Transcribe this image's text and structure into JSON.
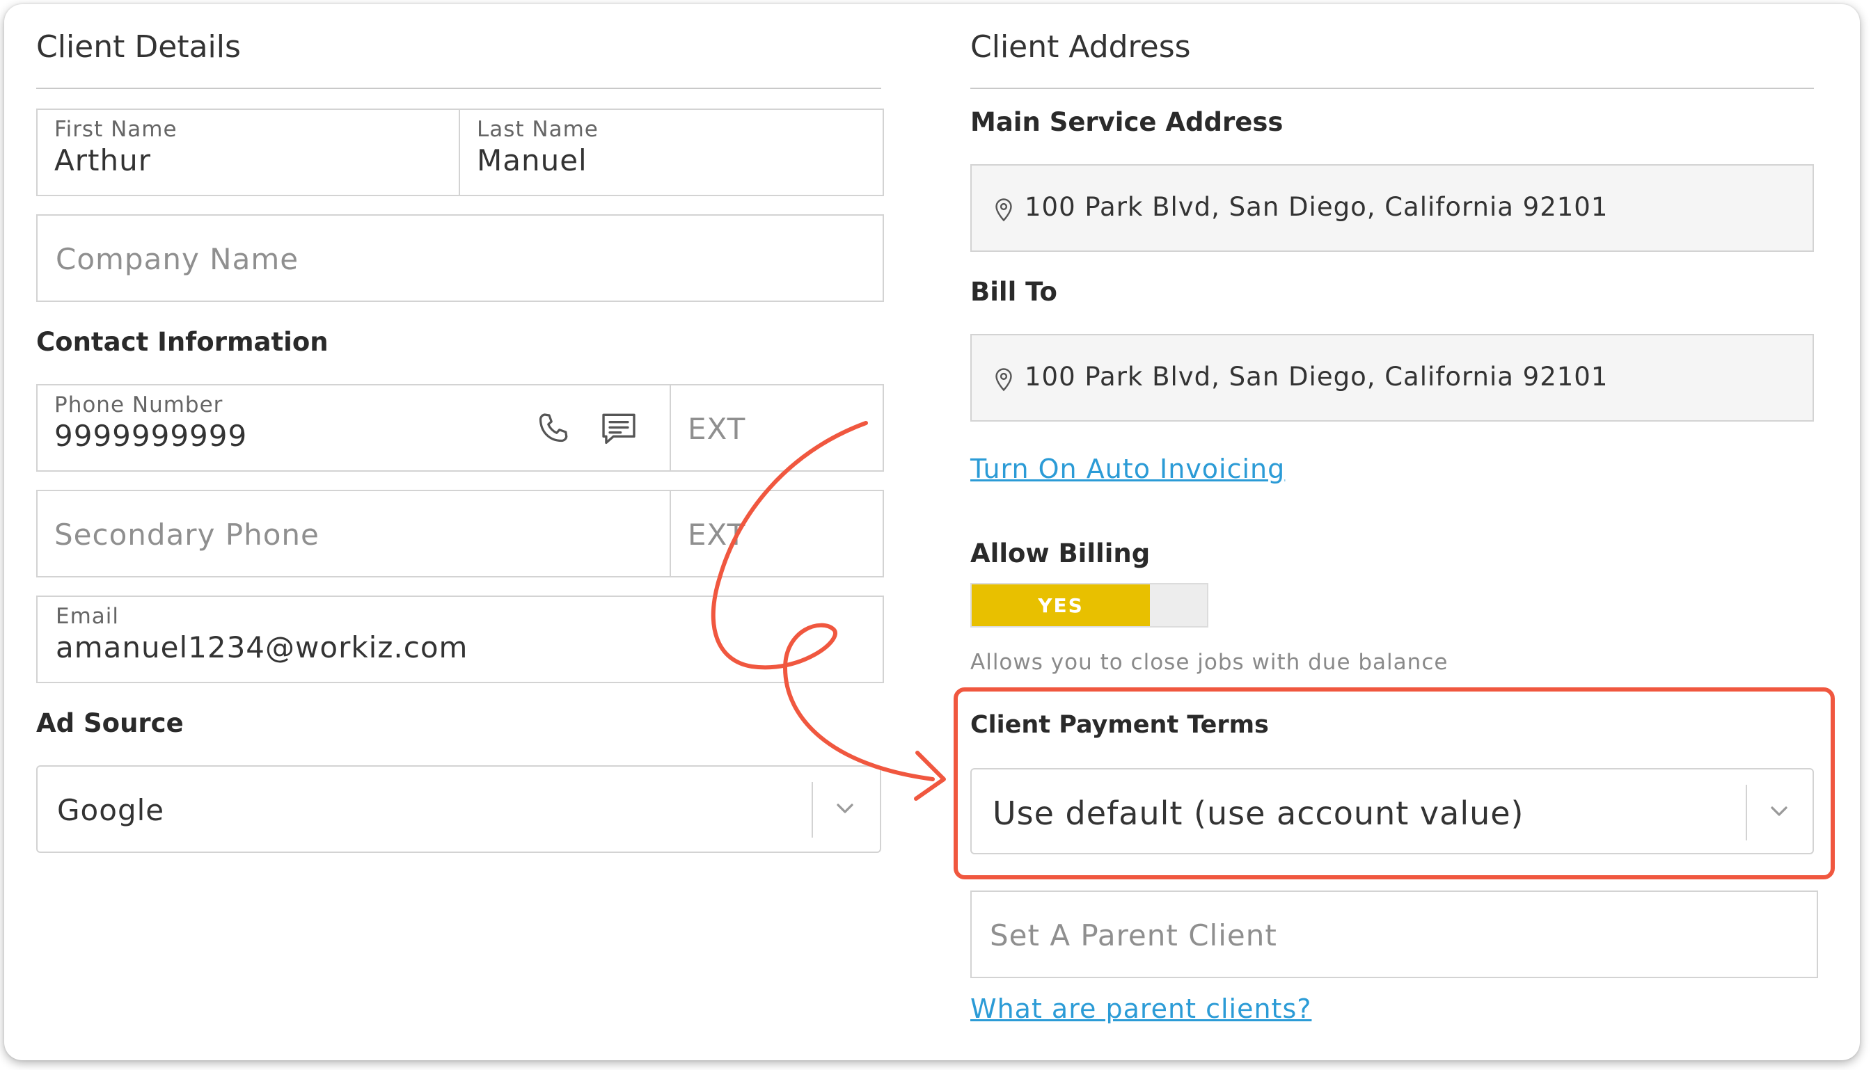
{
  "client_details": {
    "title": "Client Details",
    "first_name": {
      "label": "First Name",
      "value": "Arthur"
    },
    "last_name": {
      "label": "Last Name",
      "value": "Manuel"
    },
    "company": {
      "placeholder": "Company Name"
    },
    "contact_heading": "Contact Information",
    "phone": {
      "label": "Phone Number",
      "value": "9999999999",
      "ext_placeholder": "EXT"
    },
    "secondary_phone": {
      "placeholder": "Secondary Phone",
      "ext_placeholder": "EXT"
    },
    "email": {
      "label": "Email",
      "value": "amanuel1234@workiz.com"
    },
    "ad_source_heading": "Ad Source",
    "ad_source": {
      "value": "Google"
    }
  },
  "client_address": {
    "title": "Client Address",
    "main_service_heading": "Main Service Address",
    "main_service_address": "100 Park Blvd, San Diego, California 92101",
    "bill_to_heading": "Bill To",
    "bill_to_address": "100 Park Blvd, San Diego, California 92101",
    "auto_invoicing_link": "Turn On Auto Invoicing",
    "allow_billing_heading": "Allow Billing",
    "allow_billing_toggle": {
      "label": "YES",
      "state": "on"
    },
    "allow_billing_helper": "Allows you to close jobs with due balance",
    "payment_terms_heading": "Client Payment Terms",
    "payment_terms_value": "Use default (use account value)",
    "parent_client_placeholder": "Set A Parent Client",
    "parent_clients_link": "What are parent clients?"
  },
  "colors": {
    "annotation": "#f0573f",
    "toggle_on": "#e8c000",
    "link": "#2b9bd6"
  },
  "icons": [
    "location-pin-icon",
    "phone-icon",
    "message-icon",
    "chevron-down-icon"
  ]
}
